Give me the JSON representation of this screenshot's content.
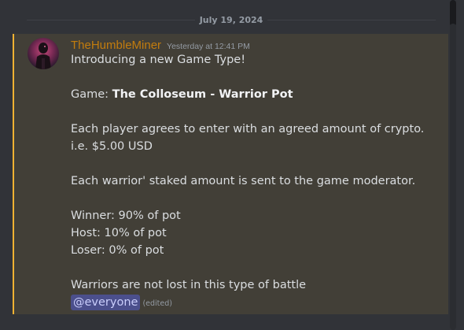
{
  "divider": {
    "date": "July 19, 2024"
  },
  "message": {
    "author": "TheHumbleMiner",
    "timestamp": "Yesterday at 12:41 PM",
    "author_color": "#c27c0e",
    "accent_color": "#f0b232",
    "lines": {
      "l1": "Introducing a new Game Type!",
      "l3_prefix": "Game: ",
      "l3_bold": "The Colloseum - Warrior Pot",
      "l5": "Each player agrees to enter with an agreed amount of crypto.",
      "l6": "i.e. $5.00 USD",
      "l8": "Each warrior' staked amount  is sent to the game moderator.",
      "l10": "Winner: 90% of pot",
      "l11": "Host: 10% of pot",
      "l12": "Loser: 0% of pot",
      "l14": "Warriors are not lost in this type of battle"
    },
    "mention": "@everyone",
    "edited": "(edited)"
  }
}
